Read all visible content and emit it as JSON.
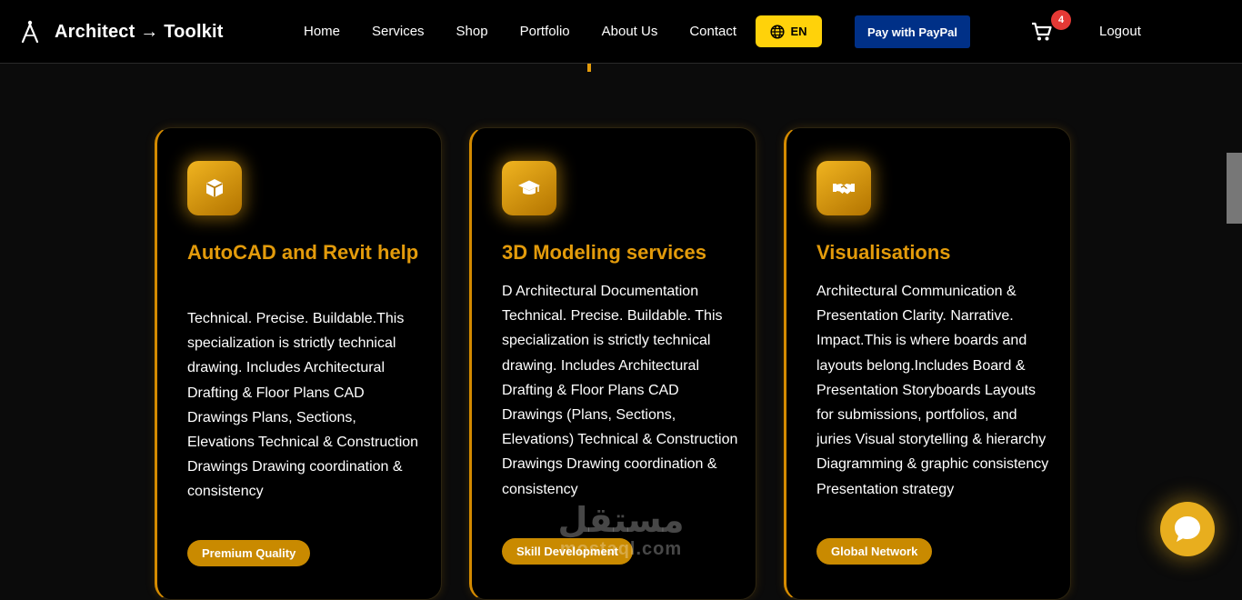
{
  "header": {
    "brand": "Architect → Toolkit",
    "nav": [
      "Home",
      "Services",
      "Shop",
      "Portfolio",
      "About Us",
      "Contact"
    ],
    "language_label": "EN",
    "paypal_label": "Pay with PayPal",
    "cart_count": "4",
    "logout_label": "Logout"
  },
  "cards": [
    {
      "icon": "cube-icon",
      "title": "AutoCAD and Revit help",
      "description": "Technical. Precise. Buildable.This specialization is strictly technical drawing. Includes Architectural Drafting & Floor Plans CAD Drawings Plans, Sections, Elevations Technical & Construction Drawings Drawing coordination & consistency",
      "badge": "Premium Quality"
    },
    {
      "icon": "graduation-cap-icon",
      "title": "3D Modeling services",
      "description": "D Architectural Documentation Technical. Precise. Buildable. This specialization is strictly technical drawing. Includes Architectural Drafting & Floor Plans CAD Drawings (Plans, Sections, Elevations) Technical & Construction Drawings Drawing coordination & consistency",
      "badge": "Skill Development"
    },
    {
      "icon": "handshake-icon",
      "title": "Visualisations",
      "description": "Architectural Communication & Presentation Clarity. Narrative. Impact.This is where boards and layouts belong.Includes Board & Presentation Storyboards Layouts for submissions, portfolios, and juries Visual storytelling & hierarchy Diagramming & graphic consistency Presentation strategy",
      "badge": "Global Network"
    }
  ],
  "watermark": {
    "arabic": "مستقل",
    "latin": "mostaql.com"
  },
  "colors": {
    "accent": "#e39b0b",
    "language_button": "#ffd20a",
    "paypal_button": "#003087",
    "badge": "#c98a00",
    "cart_badge": "#e53935"
  }
}
